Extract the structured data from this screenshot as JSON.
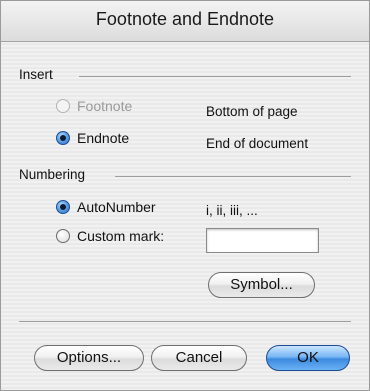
{
  "dialog": {
    "title": "Footnote and Endnote"
  },
  "insert": {
    "label": "Insert",
    "footnote_label": "Footnote",
    "footnote_desc": "Bottom of page",
    "endnote_label": "Endnote",
    "endnote_desc": "End of document",
    "selected": "Endnote"
  },
  "numbering": {
    "label": "Numbering",
    "autonumber_label": "AutoNumber",
    "autonumber_desc": "i, ii, iii, ...",
    "custom_label": "Custom mark:",
    "custom_value": "",
    "selected": "AutoNumber"
  },
  "buttons": {
    "symbol": "Symbol...",
    "options": "Options...",
    "cancel": "Cancel",
    "ok": "OK"
  },
  "colors": {
    "accent": "#3d8ae0",
    "disabled_text": "#9a9a9a"
  }
}
